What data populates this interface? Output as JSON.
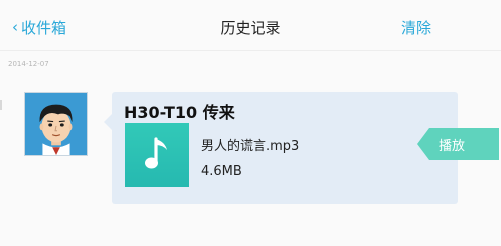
{
  "nav": {
    "back_label": "收件箱",
    "title": "历史记录",
    "clear_label": "清除"
  },
  "history": {
    "date": "2014-12-07",
    "message": {
      "sender": "H30-T10 传来",
      "file": {
        "name": "男人的谎言.mp3",
        "size": "4.6MB",
        "icon": "music-note-icon"
      },
      "play_label": "播放"
    }
  },
  "colors": {
    "accent": "#2aa8d8",
    "bubble": "#e3ecf6",
    "file_thumb": "#2bbfb3",
    "play_button": "#5fd3bd"
  }
}
